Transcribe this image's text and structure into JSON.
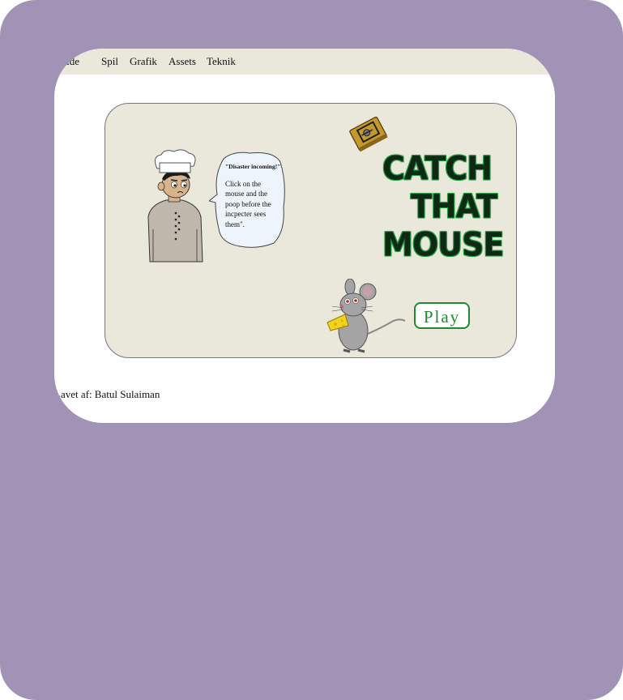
{
  "nav": {
    "items": [
      {
        "label": "Forside"
      },
      {
        "label": "Spil"
      },
      {
        "label": "Grafik"
      },
      {
        "label": "Assets"
      },
      {
        "label": "Teknik"
      }
    ]
  },
  "game": {
    "title_line1": "CATCH",
    "title_line2": "THAT",
    "title_line3": "MOUSE",
    "bubble_title": "\"Disaster incoming!\"",
    "bubble_text": "Click on the mouse and  the poop before the incpecter sees them\".",
    "play_label": "Play"
  },
  "footer": {
    "credit": "Lavet af: Batul Sulaiman"
  },
  "colors": {
    "frame": "#a193b5",
    "nav_bg": "#e9e8da",
    "game_bg": "#e9e8da",
    "accent": "#1f8a2f"
  }
}
